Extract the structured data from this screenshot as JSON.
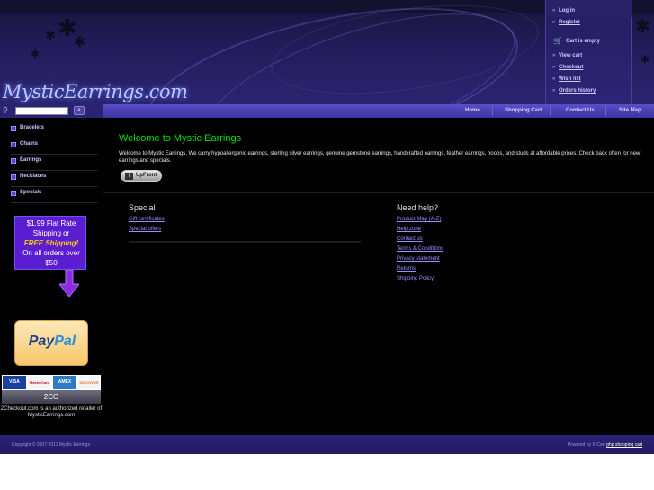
{
  "brand": {
    "logo_text": "MysticEarrings.com"
  },
  "account": {
    "links": [
      "Log in",
      "Register"
    ],
    "cart_status": "Cart is empty",
    "cart_links": [
      "View cart",
      "Checkout",
      "Wish list",
      "Orders history"
    ]
  },
  "nav": {
    "items": [
      "Home",
      "Shopping Cart",
      "Contact Us",
      "Site Map"
    ]
  },
  "search": {
    "button_label": "⌕"
  },
  "categories": [
    "Bracelets",
    "Chains",
    "Earrings",
    "Necklaces",
    "Specials"
  ],
  "promo": {
    "lines": [
      "$1.99 Flat Rate",
      "Shipping or",
      "FREE Shipping!",
      "On all orders over",
      "$50"
    ]
  },
  "paypal": {
    "label_a": "Pay",
    "label_b": "Pal"
  },
  "payment_cards": [
    "VISA",
    "MasterCard",
    "AMEX",
    "DISCOVER"
  ],
  "twocheckout": {
    "label": "2CO",
    "text": "2Checkout.com is an authorized retailer of MysticEarrings.com"
  },
  "main": {
    "title": "Welcome to Mystic Earrings",
    "text": "Welcome to Mystic Earrings. We carry hypoallergenic earrings, sterling silver earrings, genuine gemstone earrings, handcrafted earrings, feather earrings, hoops, and studs at affordable prices. Check back often for new earrings and specials.",
    "upfront_label": "UpFront"
  },
  "special": {
    "title": "Special",
    "links": [
      "Gift certificates",
      "Special offers"
    ]
  },
  "help": {
    "title": "Need help?",
    "links": [
      "Product Map (A-Z)",
      "Help zone",
      "Contact us",
      "Terms & Conditions",
      "Privacy statement",
      "Returns",
      "Shipping Policy"
    ]
  },
  "footer": {
    "copyright": "Copyright © 2007-2011 Mystic Earrings",
    "powered_prefix": "Powered by X-Cart",
    "powered_link": "php shopping cart"
  },
  "colors": {
    "accent": "#00e000",
    "link": "#9a90ff",
    "nav": "#4b42b8"
  }
}
